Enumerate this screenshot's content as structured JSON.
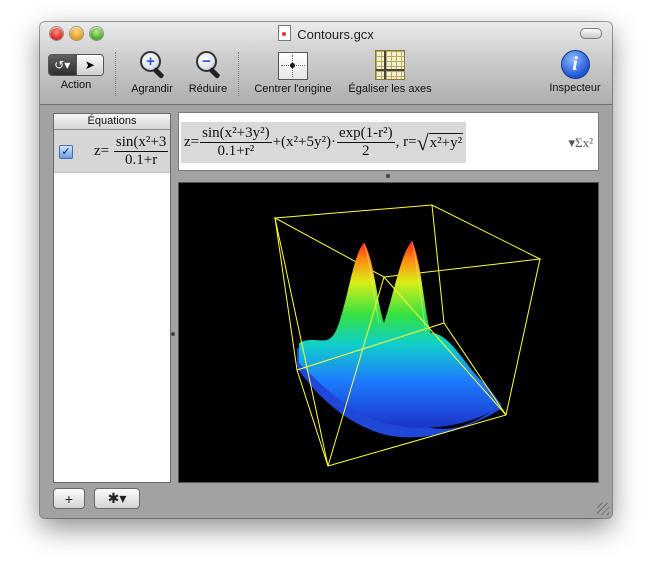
{
  "window": {
    "title": "Contours.gcx"
  },
  "toolbar": {
    "action_label": "Action",
    "zoom_in_label": "Agrandir",
    "zoom_out_label": "Réduire",
    "center_label": "Centrer l'origine",
    "equalize_label": "Égaliser les axes",
    "inspector_label": "Inspecteur"
  },
  "equations_panel": {
    "header": "Équations",
    "rows": [
      {
        "checked": true,
        "formula_lhs": "z=",
        "formula_num": "sin(x²+3",
        "formula_den": "0.1+r"
      }
    ]
  },
  "formula_bar": {
    "lhs": "z=",
    "frac1_num": "sin(x²+3y²)",
    "frac1_den": "0.1+r²",
    "mid": "+(x²+5y²)·",
    "frac2_num": "exp(1-r²)",
    "frac2_den": "2",
    "r_def": ", r=",
    "sqrt_body": "x²+y²",
    "sigma_label": "▾Σx²"
  },
  "icons": {
    "zoom_in": "zoom-in-icon",
    "zoom_out": "zoom-out-icon",
    "center": "center-origin-icon",
    "equalize": "equalize-axes-icon",
    "inspector": "info-icon",
    "add": "plus-icon",
    "gear": "gear-icon"
  },
  "bottom": {
    "add_label": "+",
    "gear_label": "✱▾"
  },
  "colors": {
    "graph_bg": "#000000",
    "box_edge": "#ffff33"
  }
}
